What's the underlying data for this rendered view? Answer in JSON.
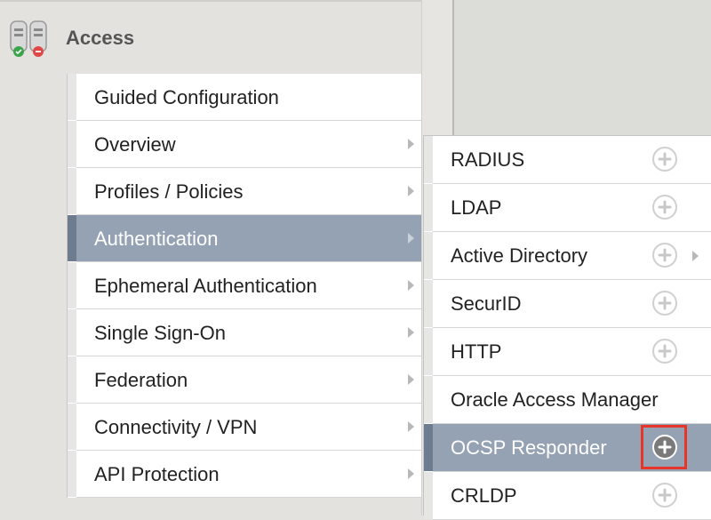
{
  "header": {
    "title": "Access",
    "icon": "access-policy-icon"
  },
  "menu": {
    "items": [
      {
        "label": "Guided Configuration",
        "has_submenu": false,
        "active": false
      },
      {
        "label": "Overview",
        "has_submenu": true,
        "active": false
      },
      {
        "label": "Profiles / Policies",
        "has_submenu": true,
        "active": false
      },
      {
        "label": "Authentication",
        "has_submenu": true,
        "active": true
      },
      {
        "label": "Ephemeral Authentication",
        "has_submenu": true,
        "active": false
      },
      {
        "label": "Single Sign-On",
        "has_submenu": true,
        "active": false
      },
      {
        "label": "Federation",
        "has_submenu": true,
        "active": false
      },
      {
        "label": "Connectivity / VPN",
        "has_submenu": true,
        "active": false
      },
      {
        "label": "API Protection",
        "has_submenu": true,
        "active": false
      }
    ]
  },
  "submenu": {
    "parent": "Authentication",
    "items": [
      {
        "label": "RADIUS",
        "has_add": true,
        "has_submenu": false,
        "active": false
      },
      {
        "label": "LDAP",
        "has_add": true,
        "has_submenu": false,
        "active": false
      },
      {
        "label": "Active Directory",
        "has_add": true,
        "has_submenu": true,
        "active": false
      },
      {
        "label": "SecurID",
        "has_add": true,
        "has_submenu": false,
        "active": false
      },
      {
        "label": "HTTP",
        "has_add": true,
        "has_submenu": false,
        "active": false
      },
      {
        "label": "Oracle Access Manager",
        "has_add": false,
        "has_submenu": false,
        "active": false
      },
      {
        "label": "OCSP Responder",
        "has_add": true,
        "has_submenu": false,
        "active": true,
        "highlighted": true
      },
      {
        "label": "CRLDP",
        "has_add": true,
        "has_submenu": false,
        "active": false
      }
    ]
  },
  "colors": {
    "active_row": "#95a2b3",
    "highlight": "#e8352a"
  }
}
